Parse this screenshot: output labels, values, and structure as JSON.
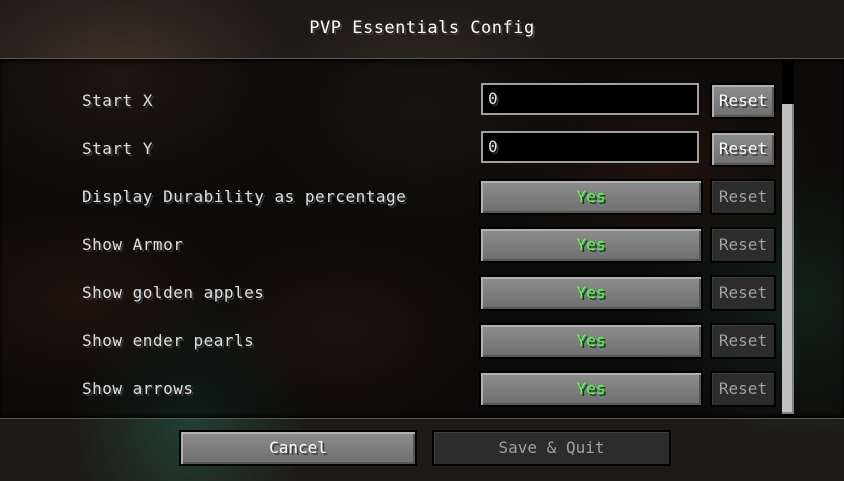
{
  "screen": {
    "title": "PVP Essentials Config"
  },
  "options": [
    {
      "label": "Start X",
      "kind": "text",
      "value": "0",
      "reset_label": "Reset",
      "reset_enabled": true
    },
    {
      "label": "Start Y",
      "kind": "text",
      "value": "0",
      "reset_label": "Reset",
      "reset_enabled": true
    },
    {
      "label": "Display Durability as percentage",
      "kind": "toggle",
      "value": "Yes",
      "reset_label": "Reset",
      "reset_enabled": false
    },
    {
      "label": "Show Armor",
      "kind": "toggle",
      "value": "Yes",
      "reset_label": "Reset",
      "reset_enabled": false
    },
    {
      "label": "Show golden apples",
      "kind": "toggle",
      "value": "Yes",
      "reset_label": "Reset",
      "reset_enabled": false
    },
    {
      "label": "Show ender pearls",
      "kind": "toggle",
      "value": "Yes",
      "reset_label": "Reset",
      "reset_enabled": false
    },
    {
      "label": "Show arrows",
      "kind": "toggle",
      "value": "Yes",
      "reset_label": "Reset",
      "reset_enabled": false
    }
  ],
  "footer": {
    "cancel_label": "Cancel",
    "save_label": "Save & Quit",
    "save_enabled": false
  },
  "colors": {
    "toggle_yes": "#55ff55",
    "enabled_text": "#ffffff",
    "disabled_text": "#a0a0a0"
  }
}
